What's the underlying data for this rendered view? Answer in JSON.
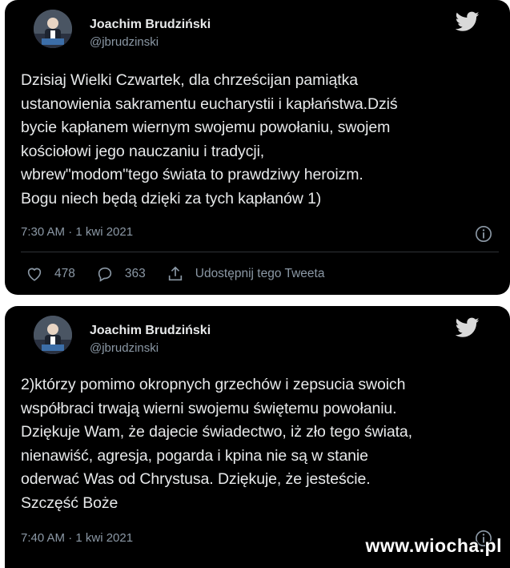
{
  "tweets": [
    {
      "author_name": "Joachim Brudziński",
      "author_handle": "@jbrudzinski",
      "text": "Dzisiaj Wielki Czwartek, dla chrześcijan pamiątka\nustanowienia sakramentu eucharystii i kapłaństwa.Dziś\nbycie kapłanem  wiernym swojemu powołaniu, swojem\nkościołowi jego nauczaniu i tradycji,\nwbrew\"modom\"tego świata to prawdziwy heroizm.\nBogu niech będą dzięki za tych kapłanów 1)",
      "timestamp": "7:30 AM · 1 kwi 2021",
      "likes": "478",
      "replies": "363",
      "share_label": "Udostępnij tego Tweeta"
    },
    {
      "author_name": "Joachim Brudziński",
      "author_handle": "@jbrudzinski",
      "text": "2)którzy pomimo okropnych grzechów i zepsucia swoich\nwspółbraci trwają wierni swojemu świętemu  powołaniu.\nDziękuje Wam, że dajecie świadectwo, iż zło tego świata,\nnienawiść, agresja, pogarda i kpina nie są w stanie\noderwać Was od  Chrystusa. Dziękuje, że jesteście.\nSzczęść Boże",
      "timestamp": "7:40 AM · 1 kwi 2021"
    }
  ],
  "watermark": "www.wiocha.pl",
  "colors": {
    "background": "#000000",
    "text": "#e7e9ea",
    "secondary": "#8b98a5",
    "divider": "#2f3336"
  },
  "icons": [
    "twitter-bird-icon",
    "info-icon",
    "heart-icon",
    "reply-icon",
    "share-icon"
  ]
}
